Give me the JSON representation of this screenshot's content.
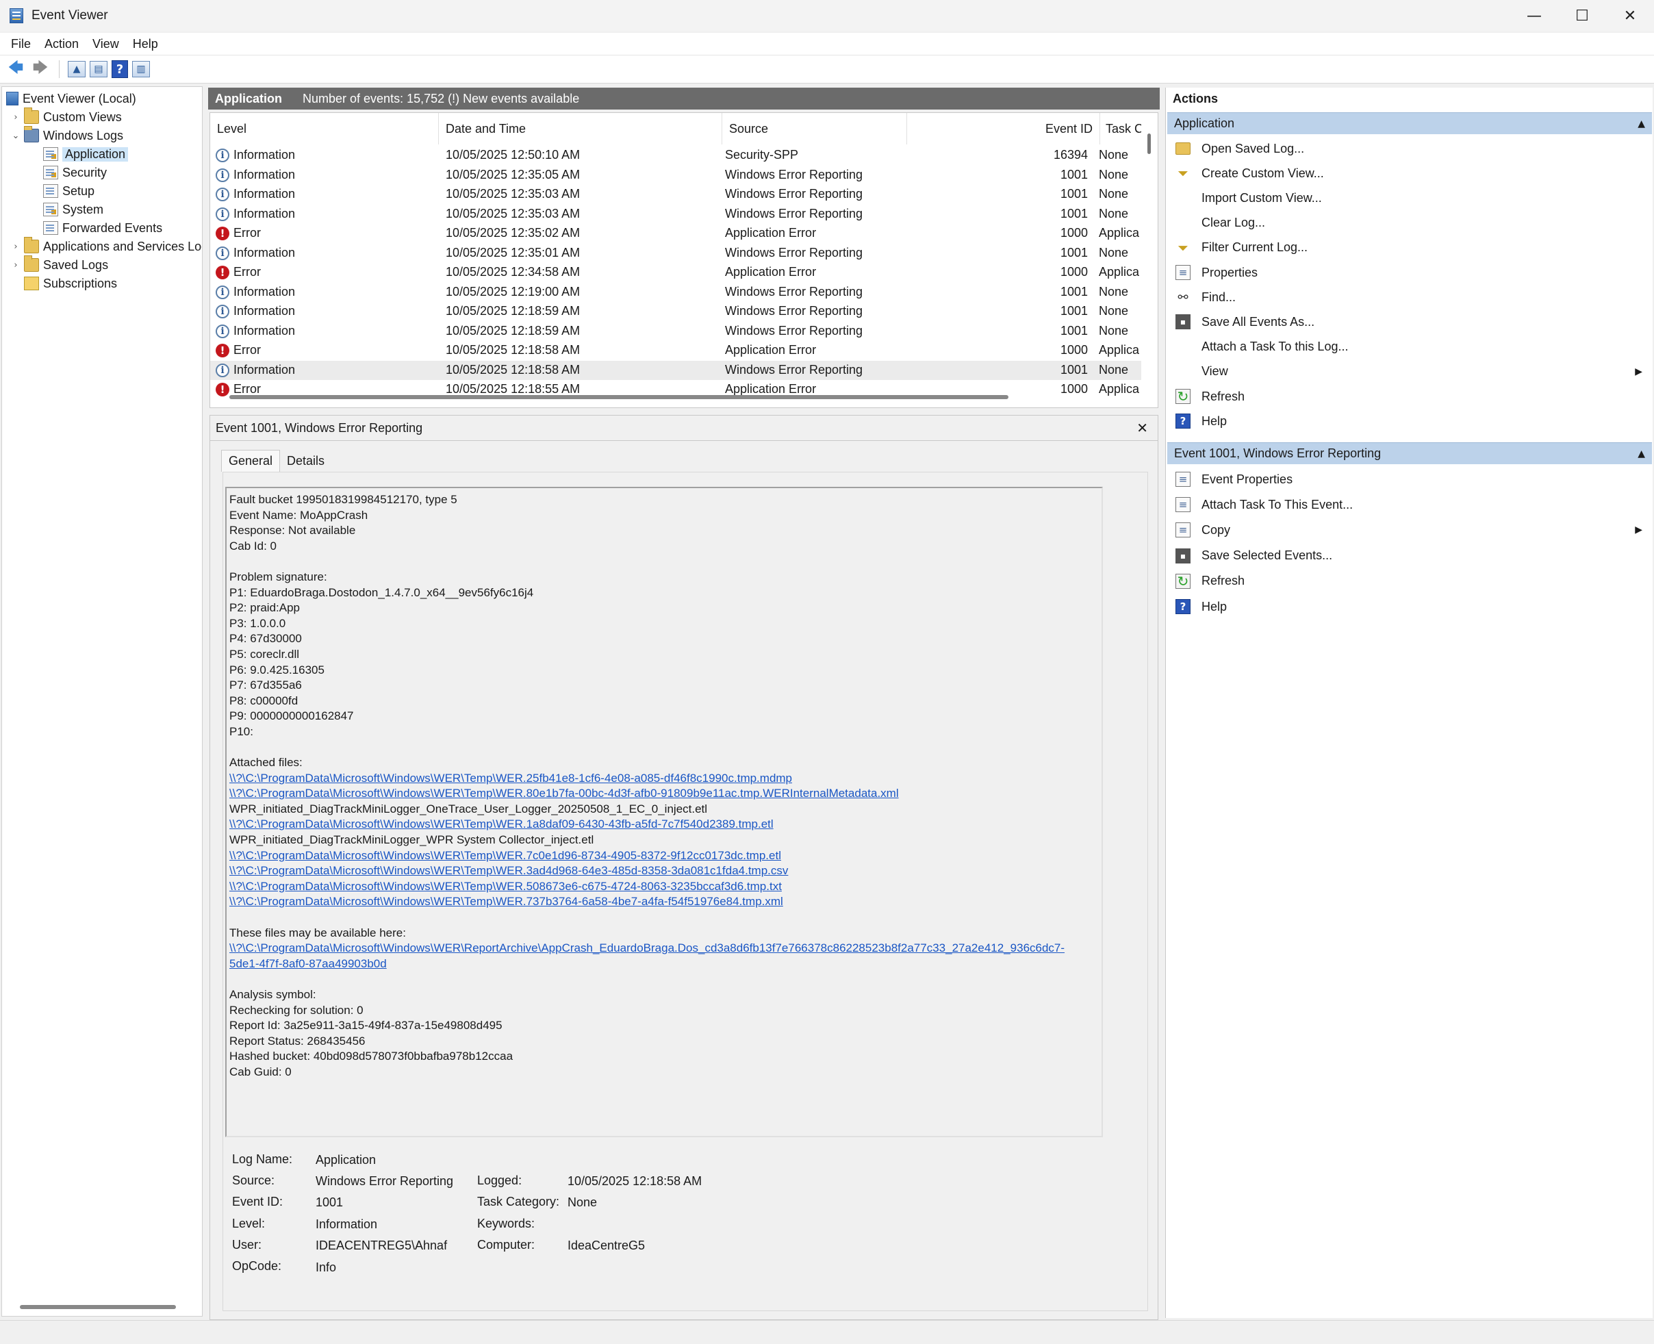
{
  "window": {
    "title": "Event Viewer",
    "minimize": "—",
    "maximize": "☐",
    "close": "✕"
  },
  "menu": [
    "File",
    "Action",
    "View",
    "Help"
  ],
  "toolbar": {
    "back": "🡄",
    "forward": "🡆",
    "help": "?"
  },
  "tree": {
    "root": "Event Viewer (Local)",
    "custom_views": "Custom Views",
    "windows_logs": "Windows Logs",
    "application": "Application",
    "security": "Security",
    "setup": "Setup",
    "system": "System",
    "forwarded": "Forwarded Events",
    "apps_services": "Applications and Services Logs",
    "saved_logs": "Saved Logs",
    "subscriptions": "Subscriptions"
  },
  "center": {
    "log_name": "Application",
    "summary": "Number of events: 15,752 (!) New events available"
  },
  "events": {
    "columns": {
      "level": "Level",
      "date": "Date and Time",
      "source": "Source",
      "event_id": "Event ID",
      "task": "Task Ca"
    },
    "rows": [
      {
        "level": "Information",
        "date": "10/05/2025 12:50:10 AM",
        "source": "Security-SPP",
        "id": "16394",
        "task": "None",
        "type": "info"
      },
      {
        "level": "Information",
        "date": "10/05/2025 12:35:05 AM",
        "source": "Windows Error Reporting",
        "id": "1001",
        "task": "None",
        "type": "info"
      },
      {
        "level": "Information",
        "date": "10/05/2025 12:35:03 AM",
        "source": "Windows Error Reporting",
        "id": "1001",
        "task": "None",
        "type": "info"
      },
      {
        "level": "Information",
        "date": "10/05/2025 12:35:03 AM",
        "source": "Windows Error Reporting",
        "id": "1001",
        "task": "None",
        "type": "info"
      },
      {
        "level": "Error",
        "date": "10/05/2025 12:35:02 AM",
        "source": "Application Error",
        "id": "1000",
        "task": "Applica",
        "type": "err"
      },
      {
        "level": "Information",
        "date": "10/05/2025 12:35:01 AM",
        "source": "Windows Error Reporting",
        "id": "1001",
        "task": "None",
        "type": "info"
      },
      {
        "level": "Error",
        "date": "10/05/2025 12:34:58 AM",
        "source": "Application Error",
        "id": "1000",
        "task": "Applica",
        "type": "err"
      },
      {
        "level": "Information",
        "date": "10/05/2025 12:19:00 AM",
        "source": "Windows Error Reporting",
        "id": "1001",
        "task": "None",
        "type": "info"
      },
      {
        "level": "Information",
        "date": "10/05/2025 12:18:59 AM",
        "source": "Windows Error Reporting",
        "id": "1001",
        "task": "None",
        "type": "info"
      },
      {
        "level": "Information",
        "date": "10/05/2025 12:18:59 AM",
        "source": "Windows Error Reporting",
        "id": "1001",
        "task": "None",
        "type": "info"
      },
      {
        "level": "Error",
        "date": "10/05/2025 12:18:58 AM",
        "source": "Application Error",
        "id": "1000",
        "task": "Applica",
        "type": "err"
      },
      {
        "level": "Information",
        "date": "10/05/2025 12:18:58 AM",
        "source": "Windows Error Reporting",
        "id": "1001",
        "task": "None",
        "type": "info",
        "selected": true
      },
      {
        "level": "Error",
        "date": "10/05/2025 12:18:55 AM",
        "source": "Application Error",
        "id": "1000",
        "task": "Applica",
        "type": "err"
      }
    ]
  },
  "detail": {
    "title": "Event 1001, Windows Error Reporting",
    "close": "✕",
    "tab_general": "General",
    "tab_details": "Details",
    "message": [
      {
        "t": "Fault bucket 1995018319984512170, type 5"
      },
      {
        "t": "Event Name: MoAppCrash"
      },
      {
        "t": "Response: Not available"
      },
      {
        "t": "Cab Id: 0"
      },
      {
        "t": ""
      },
      {
        "t": "Problem signature:"
      },
      {
        "t": "P1: EduardoBraga.Dostodon_1.4.7.0_x64__9ev56fy6c16j4"
      },
      {
        "t": "P2: praid:App"
      },
      {
        "t": "P3: 1.0.0.0"
      },
      {
        "t": "P4: 67d30000"
      },
      {
        "t": "P5: coreclr.dll"
      },
      {
        "t": "P6: 9.0.425.16305"
      },
      {
        "t": "P7: 67d355a6"
      },
      {
        "t": "P8: c00000fd"
      },
      {
        "t": "P9: 0000000000162847"
      },
      {
        "t": "P10:"
      },
      {
        "t": ""
      },
      {
        "t": "Attached files:"
      },
      {
        "t": "\\\\?\\C:\\ProgramData\\Microsoft\\Windows\\WER\\Temp\\WER.25fb41e8-1cf6-4e08-a085-df46f8c1990c.tmp.mdmp",
        "link": true
      },
      {
        "t": "\\\\?\\C:\\ProgramData\\Microsoft\\Windows\\WER\\Temp\\WER.80e1b7fa-00bc-4d3f-afb0-91809b9e11ac.tmp.WERInternalMetadata.xml",
        "link": true
      },
      {
        "t": "WPR_initiated_DiagTrackMiniLogger_OneTrace_User_Logger_20250508_1_EC_0_inject.etl"
      },
      {
        "t": "\\\\?\\C:\\ProgramData\\Microsoft\\Windows\\WER\\Temp\\WER.1a8daf09-6430-43fb-a5fd-7c7f540d2389.tmp.etl",
        "link": true
      },
      {
        "t": "WPR_initiated_DiagTrackMiniLogger_WPR System Collector_inject.etl"
      },
      {
        "t": "\\\\?\\C:\\ProgramData\\Microsoft\\Windows\\WER\\Temp\\WER.7c0e1d96-8734-4905-8372-9f12cc0173dc.tmp.etl",
        "link": true
      },
      {
        "t": "\\\\?\\C:\\ProgramData\\Microsoft\\Windows\\WER\\Temp\\WER.3ad4d968-64e3-485d-8358-3da081c1fda4.tmp.csv",
        "link": true
      },
      {
        "t": "\\\\?\\C:\\ProgramData\\Microsoft\\Windows\\WER\\Temp\\WER.508673e6-c675-4724-8063-3235bccaf3d6.tmp.txt",
        "link": true
      },
      {
        "t": "\\\\?\\C:\\ProgramData\\Microsoft\\Windows\\WER\\Temp\\WER.737b3764-6a58-4be7-a4fa-f54f51976e84.tmp.xml",
        "link": true
      },
      {
        "t": ""
      },
      {
        "t": "These files may be available here:"
      },
      {
        "t": "\\\\?\\C:\\ProgramData\\Microsoft\\Windows\\WER\\ReportArchive\\AppCrash_EduardoBraga.Dos_cd3a8d6fb13f7e766378c86228523b8f2a77c33_27a2e412_936c6dc7-",
        "link": true
      },
      {
        "t": "5de1-4f7f-8af0-87aa49903b0d",
        "link": true
      },
      {
        "t": ""
      },
      {
        "t": "Analysis symbol:"
      },
      {
        "t": "Rechecking for solution: 0"
      },
      {
        "t": "Report Id: 3a25e911-3a15-49f4-837a-15e49808d495"
      },
      {
        "t": "Report Status: 268435456"
      },
      {
        "t": "Hashed bucket: 40bd098d578073f0bbafba978b12ccaa"
      },
      {
        "t": "Cab Guid: 0"
      }
    ],
    "props": {
      "log_name_k": "Log Name:",
      "log_name_v": "Application",
      "source_k": "Source:",
      "source_v": "Windows Error Reporting",
      "logged_k": "Logged:",
      "logged_v": "10/05/2025 12:18:58 AM",
      "event_id_k": "Event ID:",
      "event_id_v": "1001",
      "task_k": "Task Category:",
      "task_v": "None",
      "level_k": "Level:",
      "level_v": "Information",
      "keywords_k": "Keywords:",
      "keywords_v": "",
      "user_k": "User:",
      "user_v": "IDEACENTREG5\\Ahnaf",
      "computer_k": "Computer:",
      "computer_v": "IdeaCentreG5",
      "opcode_k": "OpCode:",
      "opcode_v": "Info"
    }
  },
  "actions": {
    "title": "Actions",
    "section1": "Application",
    "section1_items": [
      {
        "label": "Open Saved Log...",
        "icon": "folder"
      },
      {
        "label": "Create Custom View...",
        "icon": "filter"
      },
      {
        "label": "Import Custom View...",
        "icon": "blank"
      },
      {
        "label": "Clear Log...",
        "icon": "blank"
      },
      {
        "label": "Filter Current Log...",
        "icon": "filter"
      },
      {
        "label": "Properties",
        "icon": "doc"
      },
      {
        "label": "Find...",
        "icon": "find"
      },
      {
        "label": "Save All Events As...",
        "icon": "save"
      },
      {
        "label": "Attach a Task To this Log...",
        "icon": "blank"
      },
      {
        "label": "View",
        "icon": "blank",
        "submenu": true
      },
      {
        "label": "Refresh",
        "icon": "refresh"
      },
      {
        "label": "Help",
        "icon": "help"
      }
    ],
    "section2": "Event 1001, Windows Error Reporting",
    "section2_items": [
      {
        "label": "Event Properties",
        "icon": "doc"
      },
      {
        "label": "Attach Task To This Event...",
        "icon": "doc"
      },
      {
        "label": "Copy",
        "icon": "doc",
        "submenu": true
      },
      {
        "label": "Save Selected Events...",
        "icon": "save"
      },
      {
        "label": "Refresh",
        "icon": "refresh"
      },
      {
        "label": "Help",
        "icon": "help"
      }
    ]
  }
}
